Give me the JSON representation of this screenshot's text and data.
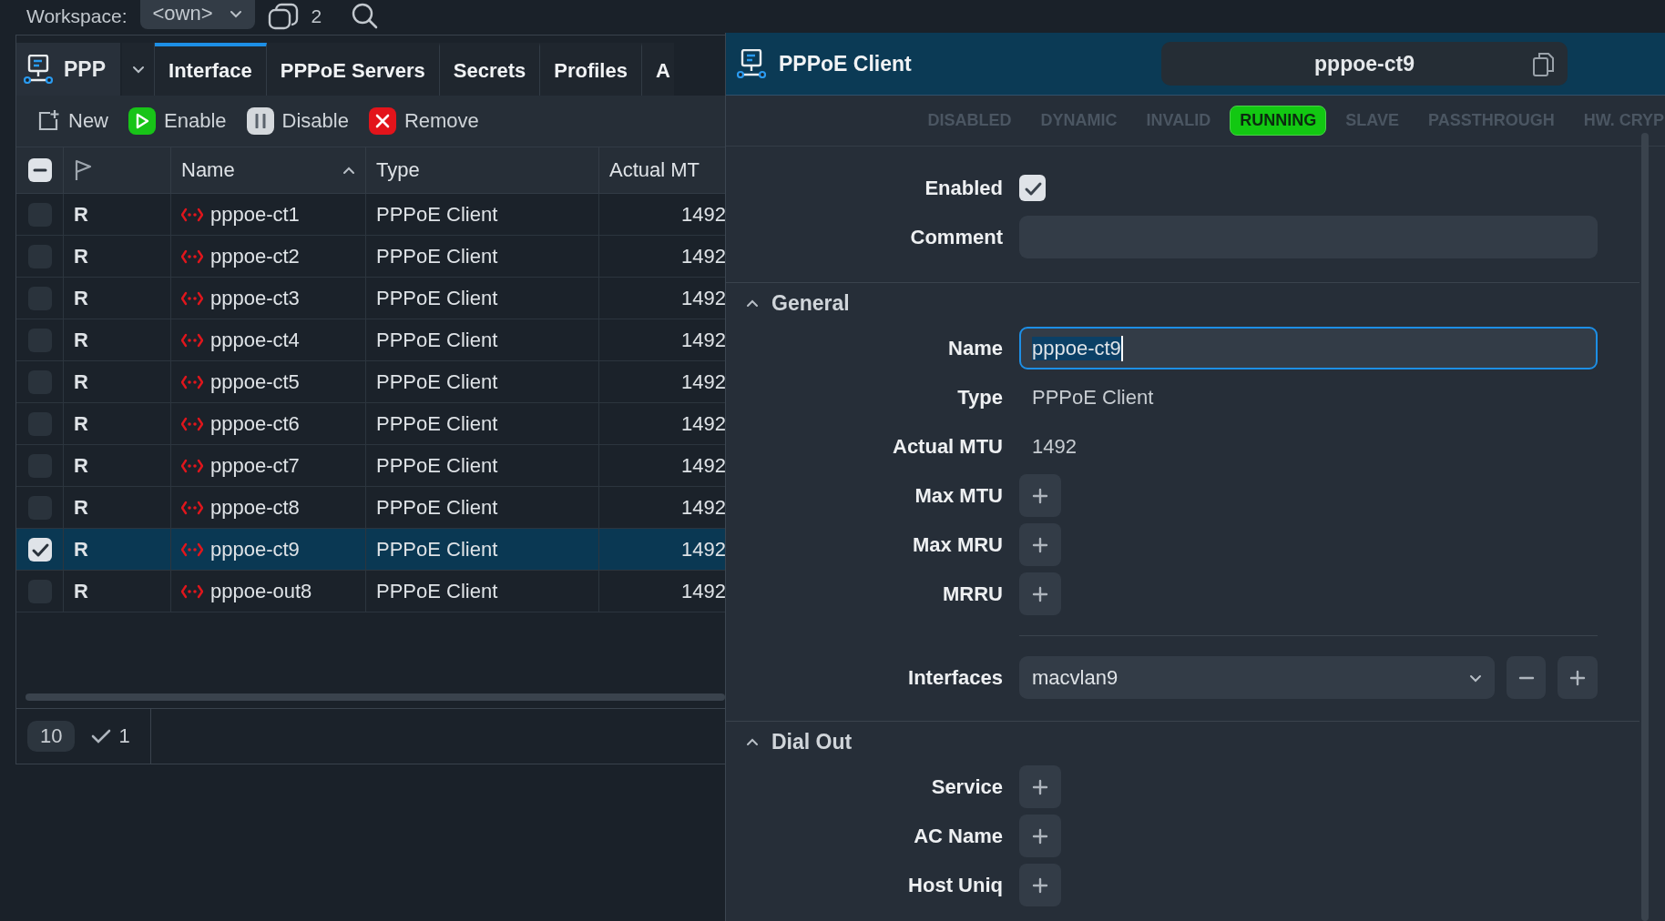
{
  "top_bar": {
    "workspace_label": "Workspace:",
    "workspace_value": "<own>",
    "session_count": "2"
  },
  "left_window": {
    "title": "PPP",
    "tabs": [
      {
        "label": "Interface",
        "selected": true
      },
      {
        "label": "PPPoE Servers",
        "selected": false
      },
      {
        "label": "Secrets",
        "selected": false
      },
      {
        "label": "Profiles",
        "selected": false
      },
      {
        "label": "A",
        "selected": false
      }
    ],
    "toolbar": [
      {
        "kind": "new",
        "label": "New"
      },
      {
        "kind": "enable",
        "label": "Enable"
      },
      {
        "kind": "disable",
        "label": "Disable"
      },
      {
        "kind": "remove",
        "label": "Remove"
      }
    ],
    "table": {
      "select_all": {
        "partially_checked": true
      },
      "columns": [
        {
          "label": "Name",
          "sorted": true
        },
        {
          "label": "Type",
          "sorted": false
        },
        {
          "label": "Actual MT",
          "sorted": false
        }
      ],
      "rows": [
        {
          "flag": "R",
          "name": "pppoe-ct1",
          "type": "PPPoE Client",
          "actual_mtu": "1492",
          "selected": false
        },
        {
          "flag": "R",
          "name": "pppoe-ct2",
          "type": "PPPoE Client",
          "actual_mtu": "1492",
          "selected": false
        },
        {
          "flag": "R",
          "name": "pppoe-ct3",
          "type": "PPPoE Client",
          "actual_mtu": "1492",
          "selected": false
        },
        {
          "flag": "R",
          "name": "pppoe-ct4",
          "type": "PPPoE Client",
          "actual_mtu": "1492",
          "selected": false
        },
        {
          "flag": "R",
          "name": "pppoe-ct5",
          "type": "PPPoE Client",
          "actual_mtu": "1492",
          "selected": false
        },
        {
          "flag": "R",
          "name": "pppoe-ct6",
          "type": "PPPoE Client",
          "actual_mtu": "1492",
          "selected": false
        },
        {
          "flag": "R",
          "name": "pppoe-ct7",
          "type": "PPPoE Client",
          "actual_mtu": "1492",
          "selected": false
        },
        {
          "flag": "R",
          "name": "pppoe-ct8",
          "type": "PPPoE Client",
          "actual_mtu": "1492",
          "selected": false
        },
        {
          "flag": "R",
          "name": "pppoe-ct9",
          "type": "PPPoE Client",
          "actual_mtu": "1492",
          "selected": true
        },
        {
          "flag": "R",
          "name": "pppoe-out8",
          "type": "PPPoE Client",
          "actual_mtu": "1492",
          "selected": false
        }
      ]
    },
    "footer": {
      "count": "10",
      "selected_count": "1"
    }
  },
  "right_panel": {
    "title": "PPPoE Client",
    "name": "pppoe-ct9",
    "flags": [
      {
        "label": "DISABLED",
        "on": false
      },
      {
        "label": "DYNAMIC",
        "on": false
      },
      {
        "label": "INVALID",
        "on": false
      },
      {
        "label": "RUNNING",
        "on": true
      },
      {
        "label": "SLAVE",
        "on": false
      },
      {
        "label": "PASSTHROUGH",
        "on": false
      },
      {
        "label": "HW. CRYP",
        "on": false
      }
    ],
    "enabled": {
      "label": "Enabled",
      "checked": true
    },
    "comment": {
      "label": "Comment"
    },
    "sections": [
      {
        "title": "General",
        "expanded": true,
        "fields": [
          {
            "kind": "input",
            "label": "Name",
            "value": "pppoe-ct9",
            "focused": true
          },
          {
            "kind": "text",
            "label": "Type",
            "value": "PPPoE Client"
          },
          {
            "kind": "text",
            "label": "Actual MTU",
            "value": "1492"
          },
          {
            "kind": "add",
            "label": "Max MTU"
          },
          {
            "kind": "add",
            "label": "Max MRU"
          },
          {
            "kind": "add",
            "label": "MRRU"
          },
          {
            "kind": "select",
            "label": "Interfaces",
            "value": "macvlan9"
          }
        ]
      },
      {
        "title": "Dial Out",
        "expanded": true,
        "fields": [
          {
            "kind": "add",
            "label": "Service"
          },
          {
            "kind": "add",
            "label": "AC Name"
          },
          {
            "kind": "add",
            "label": "Host Uniq"
          }
        ]
      }
    ]
  }
}
